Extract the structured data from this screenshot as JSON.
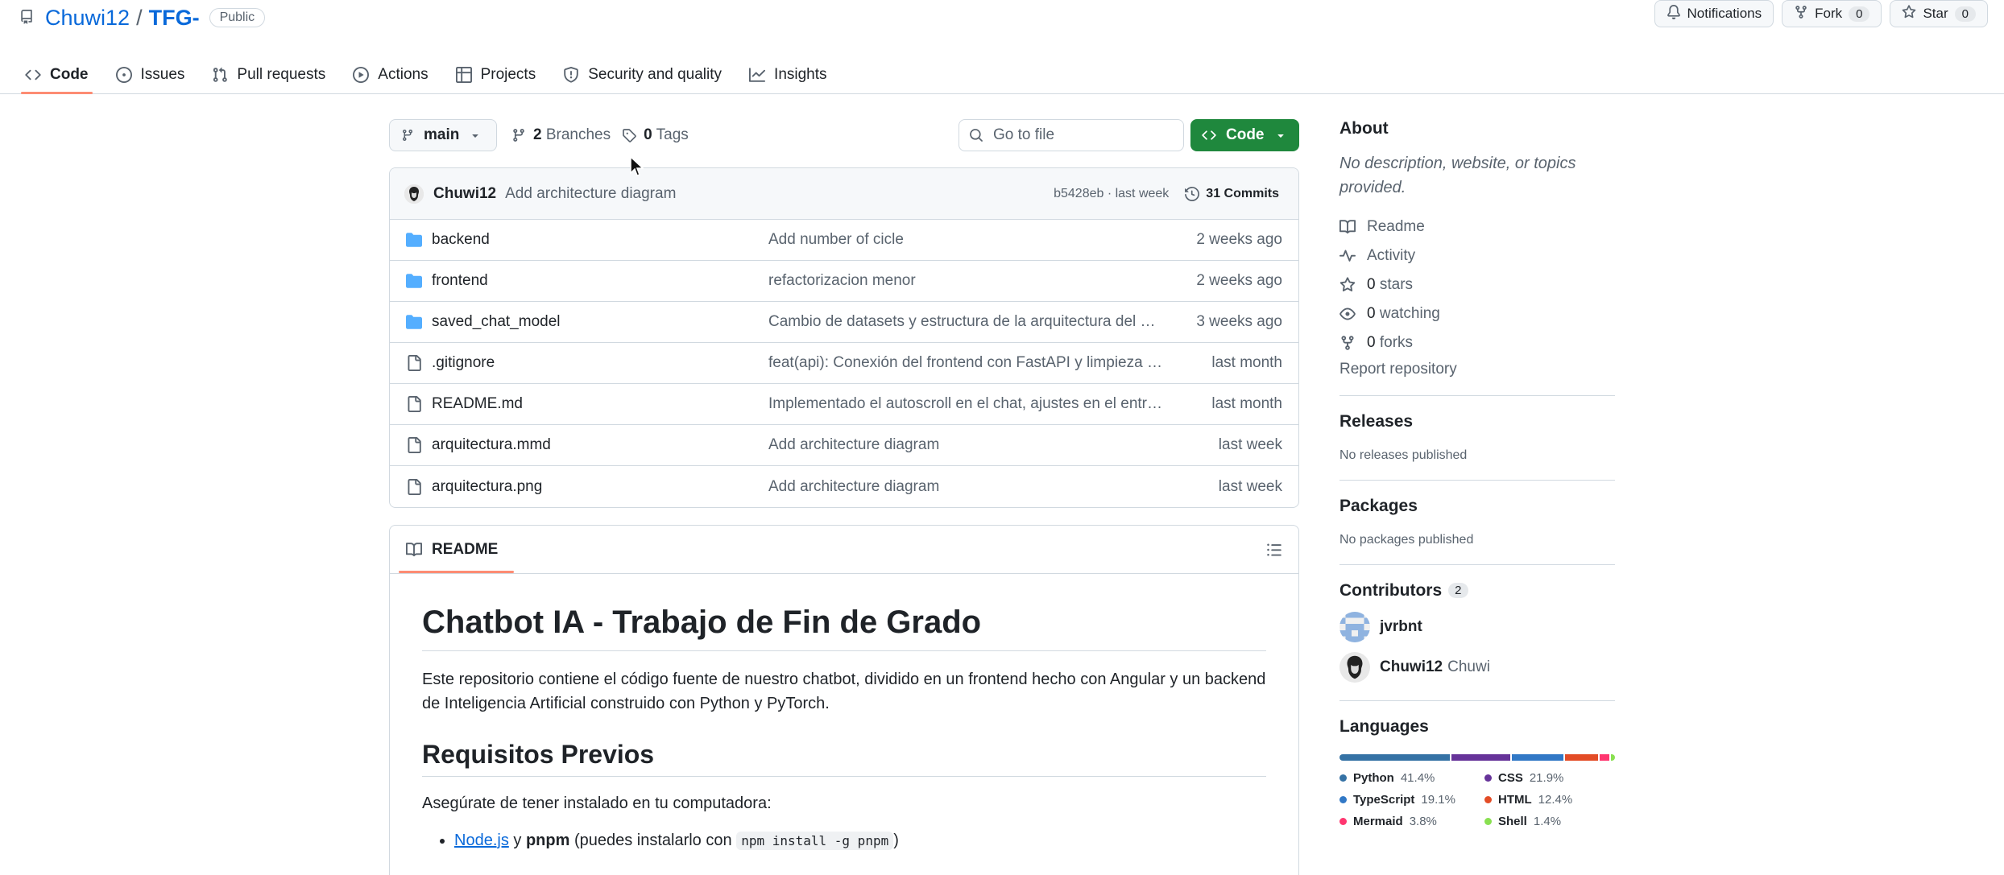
{
  "repo": {
    "owner": "Chuwi12",
    "separator": "/",
    "name": "TFG-",
    "visibility": "Public"
  },
  "header_buttons": {
    "notifications": "Notifications",
    "fork_label": "Fork",
    "fork_count": "0",
    "star_label": "Star",
    "star_count": "0"
  },
  "tabs": [
    {
      "label": "Code",
      "icon": "code-icon",
      "active": true
    },
    {
      "label": "Issues",
      "icon": "issue-icon"
    },
    {
      "label": "Pull requests",
      "icon": "pull-request-icon"
    },
    {
      "label": "Actions",
      "icon": "play-icon"
    },
    {
      "label": "Projects",
      "icon": "table-icon"
    },
    {
      "label": "Security and quality",
      "icon": "shield-icon"
    },
    {
      "label": "Insights",
      "icon": "graph-icon"
    }
  ],
  "toolbar": {
    "branch": "main",
    "branches_count": "2",
    "branches_label": "Branches",
    "tags_count": "0",
    "tags_label": "Tags",
    "goto_placeholder": "Go to file",
    "code_button": "Code"
  },
  "latest_commit": {
    "author": "Chuwi12",
    "message": "Add architecture diagram",
    "hash_time": "b5428eb · last week",
    "commits": "31 Commits"
  },
  "files": [
    {
      "type": "folder",
      "name": "backend",
      "message": "Add number of cicle",
      "date": "2 weeks ago"
    },
    {
      "type": "folder",
      "name": "frontend",
      "message": "refactorizacion menor",
      "date": "2 weeks ago"
    },
    {
      "type": "folder",
      "name": "saved_chat_model",
      "message": "Cambio de datasets y estructura de la arquitectura del pr...",
      "date": "3 weeks ago"
    },
    {
      "type": "file",
      "name": ".gitignore",
      "message": "feat(api): Conexión del frontend con FastAPI y limpieza de...",
      "date": "last month"
    },
    {
      "type": "file",
      "name": "README.md",
      "message": "Implementado el autoscroll en el chat, ajustes en el entre...",
      "date": "last month"
    },
    {
      "type": "file",
      "name": "arquitectura.mmd",
      "message": "Add architecture diagram",
      "date": "last week"
    },
    {
      "type": "file",
      "name": "arquitectura.png",
      "message": "Add architecture diagram",
      "date": "last week"
    }
  ],
  "readme": {
    "tab_label": "README",
    "h1": "Chatbot IA - Trabajo de Fin de Grado",
    "intro": "Este repositorio contiene el código fuente de nuestro chatbot, dividido en un frontend hecho con Angular y un backend de Inteligencia Artificial construido con Python y PyTorch.",
    "h2": "Requisitos Previos",
    "ensure": "Asegúrate de tener instalado en tu computadora:",
    "li1_link": "Node.js",
    "li1_and": "y",
    "li1_bold": "pnpm",
    "li1_text": "(puedes instalarlo con",
    "li1_code": "npm install -g pnpm",
    "li1_end": ")"
  },
  "about": {
    "title": "About",
    "description": "No description, website, or topics provided.",
    "readme": "Readme",
    "activity": "Activity",
    "stars_count": "0",
    "stars_label": "stars",
    "watching_count": "0",
    "watching_label": "watching",
    "forks_count": "0",
    "forks_label": "forks",
    "report": "Report repository"
  },
  "releases": {
    "title": "Releases",
    "subtitle": "No releases published"
  },
  "packages": {
    "title": "Packages",
    "subtitle": "No packages published"
  },
  "contributors": {
    "title": "Contributors",
    "count": "2",
    "list": [
      {
        "login": "jvrbnt",
        "name": ""
      },
      {
        "login": "Chuwi12",
        "name": "Chuwi"
      }
    ]
  },
  "languages": {
    "title": "Languages",
    "items": [
      {
        "name": "Python",
        "percent": "41.4%",
        "value": 41.4,
        "color": "#3572A5"
      },
      {
        "name": "CSS",
        "percent": "21.9%",
        "value": 21.9,
        "color": "#663399"
      },
      {
        "name": "TypeScript",
        "percent": "19.1%",
        "value": 19.1,
        "color": "#3178c6"
      },
      {
        "name": "HTML",
        "percent": "12.4%",
        "value": 12.4,
        "color": "#e34c26"
      },
      {
        "name": "Mermaid",
        "percent": "3.8%",
        "value": 3.8,
        "color": "#ff3670"
      },
      {
        "name": "Shell",
        "percent": "1.4%",
        "value": 1.4,
        "color": "#89e051"
      }
    ]
  }
}
